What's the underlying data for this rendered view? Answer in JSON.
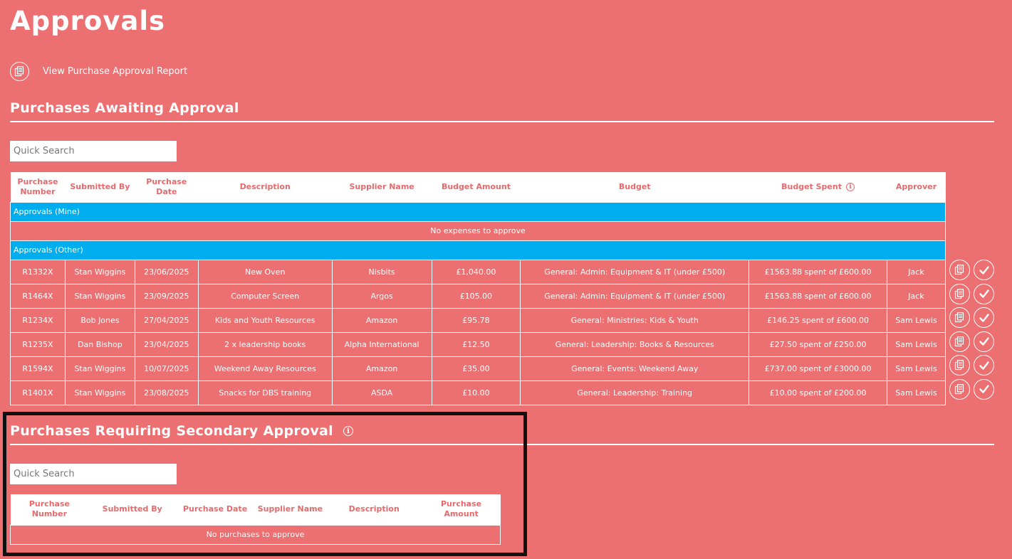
{
  "page": {
    "title": "Approvals"
  },
  "report_link": {
    "label": "View Purchase Approval Report",
    "icon": "document-copy-icon"
  },
  "awaiting": {
    "title": "Purchases Awaiting Approval",
    "search_placeholder": "Quick Search",
    "columns": {
      "purchase_number": "Purchase Number",
      "submitted_by": "Submitted By",
      "purchase_date": "Purchase Date",
      "description": "Description",
      "supplier_name": "Supplier Name",
      "budget_amount": "Budget Amount",
      "budget": "Budget",
      "budget_spent": "Budget Spent",
      "approver": "Approver"
    },
    "groups": {
      "mine_label": "Approvals (Mine)",
      "mine_empty": "No expenses to approve",
      "other_label": "Approvals (Other)"
    },
    "rows": [
      {
        "number": "R1332X",
        "submitted_by": "Stan Wiggins",
        "date": "23/06/2025",
        "description": "New Oven",
        "supplier": "Nisbits",
        "amount": "£1,040.00",
        "budget": "General: Admin: Equipment & IT (under £500)",
        "spent": "£1563.88 spent of £600.00",
        "approver": "Jack"
      },
      {
        "number": "R1464X",
        "submitted_by": "Stan Wiggins",
        "date": "23/09/2025",
        "description": "Computer Screen",
        "supplier": "Argos",
        "amount": "£105.00",
        "budget": "General: Admin: Equipment & IT (under £500)",
        "spent": "£1563.88 spent of £600.00",
        "approver": "Jack"
      },
      {
        "number": "R1234X",
        "submitted_by": "Bob Jones",
        "date": "27/04/2025",
        "description": "Kids and Youth Resources",
        "supplier": "Amazon",
        "amount": "£95.78",
        "budget": "General: Ministries: Kids & Youth",
        "spent": "£146.25 spent of £600.00",
        "approver": "Sam Lewis"
      },
      {
        "number": "R1235X",
        "submitted_by": "Dan Bishop",
        "date": "23/04/2025",
        "description": "2 x leadership books",
        "supplier": "Alpha International",
        "amount": "£12.50",
        "budget": "General: Leadership: Books & Resources",
        "spent": "£27.50 spent of £250.00",
        "approver": "Sam Lewis"
      },
      {
        "number": "R1594X",
        "submitted_by": "Stan Wiggins",
        "date": "10/07/2025",
        "description": "Weekend Away Resources",
        "supplier": "Amazon",
        "amount": "£35.00",
        "budget": "General: Events: Weekend Away",
        "spent": "£737.00 spent of £3000.00",
        "approver": "Sam Lewis"
      },
      {
        "number": "R1401X",
        "submitted_by": "Stan Wiggins",
        "date": "23/08/2025",
        "description": "Snacks for DBS training",
        "supplier": "ASDA",
        "amount": "£10.00",
        "budget": "General: Leadership: Training",
        "spent": "£10.00 spent of £200.00",
        "approver": "Sam Lewis"
      }
    ],
    "row_actions": {
      "view_icon": "document-copy-icon",
      "approve_icon": "checkmark-icon"
    }
  },
  "secondary": {
    "title": "Purchases Requiring Secondary Approval",
    "search_placeholder": "Quick Search",
    "columns": {
      "purchase_number": "Purchase Number",
      "submitted_by": "Submitted By",
      "purchase_date": "Purchase Date",
      "supplier_name": "Supplier Name",
      "description": "Description",
      "purchase_amount": "Purchase Amount"
    },
    "empty": "No purchases to approve"
  },
  "colors": {
    "background": "#ec6f71",
    "header_text": "#e56a6c",
    "group_row": "#00aeef",
    "highlight_border": "#111111"
  }
}
